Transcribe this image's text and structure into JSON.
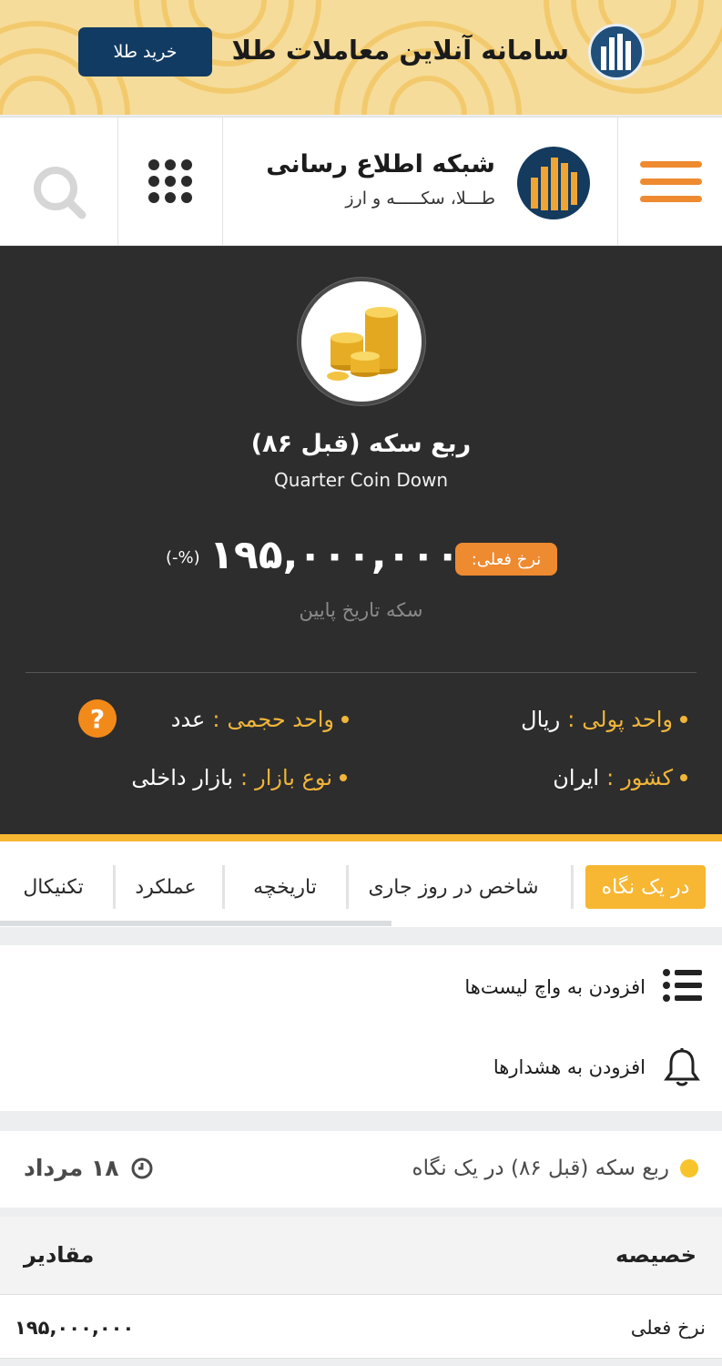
{
  "promo": {
    "title": "سامانه آنلاین معاملات طلا",
    "button": "خرید طلا",
    "logo_icon": "bar-chart-logo-icon"
  },
  "header": {
    "brand_title": "شبکه اطلاع رسانی",
    "brand_subtitle": "طـــلا، سکـــــه و ارز",
    "menu_icon": "hamburger-menu-icon",
    "apps_icon": "grid-apps-icon",
    "search_icon": "search-icon",
    "accent": "#ee8a30"
  },
  "asset": {
    "name_fa": "ربع سکه (قبل ۸۶)",
    "name_en": "Quarter Coin Down",
    "price_badge": "نرخ فعلی:",
    "price": "۱۹۵,۰۰۰,۰۰۰",
    "change": "(-%)",
    "note": "سکه تاریخ پایین",
    "image_icon": "gold-coins-icon"
  },
  "attributes": {
    "currency_key": "واحد پولی",
    "currency_val": "ریال",
    "volume_key": "واحد حجمی",
    "volume_val": "عدد",
    "country_key": "کشور",
    "country_val": "ایران",
    "market_key": "نوع بازار",
    "market_val": "بازار داخلی",
    "separator": ":"
  },
  "tabs": [
    {
      "label": "در یک نگاه",
      "active": true
    },
    {
      "label": "شاخص در روز جاری",
      "active": false
    },
    {
      "label": "تاریخچه",
      "active": false
    },
    {
      "label": "عملکرد",
      "active": false
    },
    {
      "label": "تکنیکال",
      "active": false
    }
  ],
  "actions": {
    "watchlist": "افزودن به واچ لیست‌ها",
    "alerts": "افزودن به هشدارها"
  },
  "summary": {
    "title": "ربع سکه (قبل ۸۶) در یک نگاه",
    "date": "۱۸ مرداد"
  },
  "table": {
    "headers": {
      "property": "خصیصه",
      "values": "مقادیر"
    },
    "rows": [
      {
        "property": "نرخ فعلی",
        "value": "۱۹۵,۰۰۰,۰۰۰"
      }
    ]
  },
  "colors": {
    "dark_bg": "#2d2d2d",
    "gold": "#f7b733",
    "navy": "#123b63"
  }
}
